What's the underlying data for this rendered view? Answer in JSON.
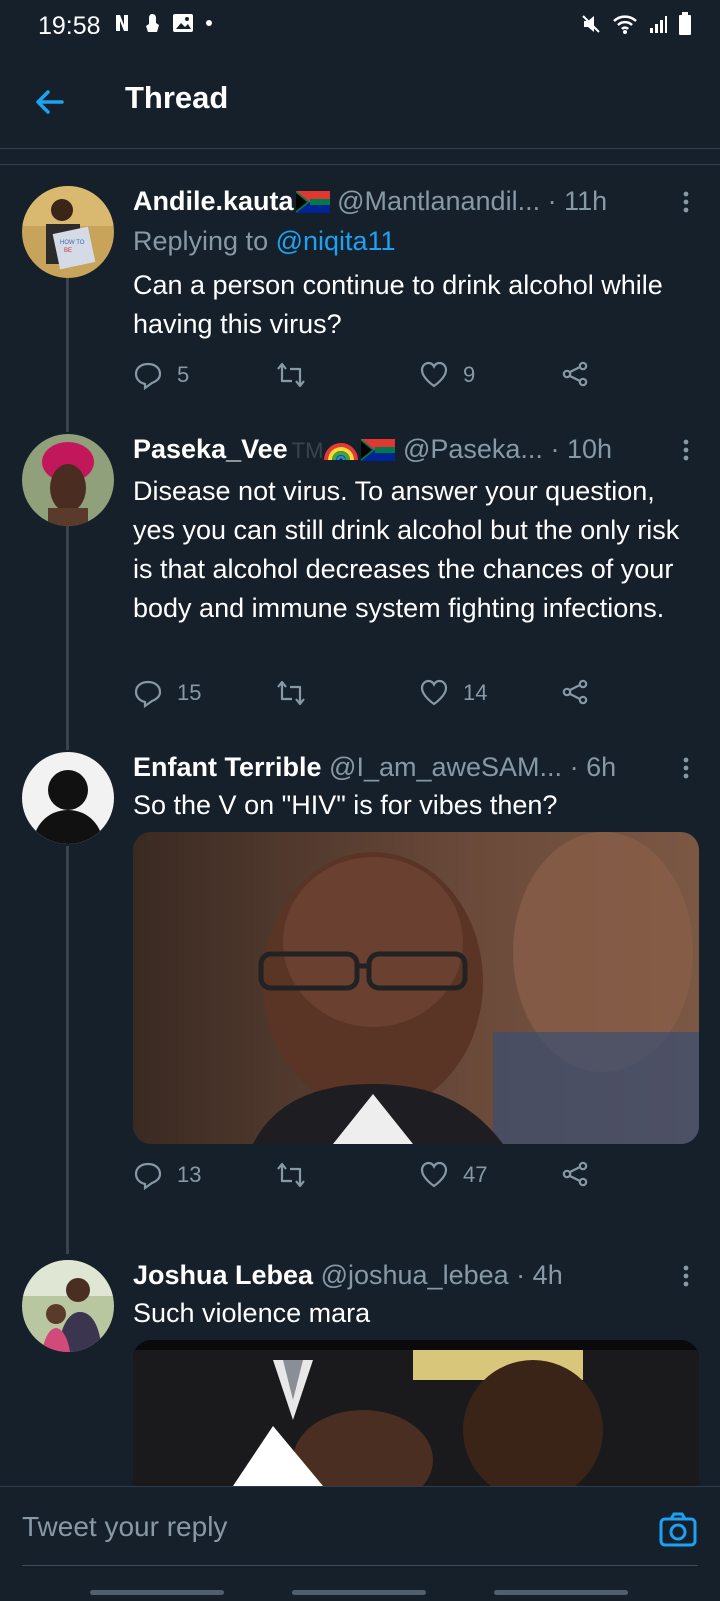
{
  "status": {
    "time": "19:58"
  },
  "header": {
    "title": "Thread"
  },
  "tweets": [
    {
      "name": "Andile.kauta",
      "handle": "@Mantlanandil...",
      "time": "11h",
      "replying_prefix": "Replying to ",
      "replying_to": "@niqita11",
      "text": "Can a person continue to drink alcohol while having this virus?",
      "replies": "5",
      "retweets": "",
      "likes": "9"
    },
    {
      "name": "Paseka_Vee",
      "name_suffix": "TM",
      "handle": "@Paseka...",
      "time": "10h",
      "text": "Disease not virus. To answer your question, yes you can still drink alcohol but the only risk is that alcohol decreases the chances of your body and immune system fighting infections.",
      "replies": "15",
      "retweets": "",
      "likes": "14"
    },
    {
      "name": "Enfant Terrible",
      "handle": "@I_am_aweSAM...",
      "time": "6h",
      "text": "So the V on \"HIV\" is for vibes then?",
      "replies": "13",
      "retweets": "",
      "likes": "47"
    },
    {
      "name": "Joshua Lebea",
      "handle": "@joshua_lebea",
      "time": "4h",
      "text": "Such violence mara"
    }
  ],
  "reply": {
    "placeholder": "Tweet your reply"
  },
  "colors": {
    "background": "#15202b",
    "accent": "#1da1f2",
    "secondary": "#8899a6"
  }
}
